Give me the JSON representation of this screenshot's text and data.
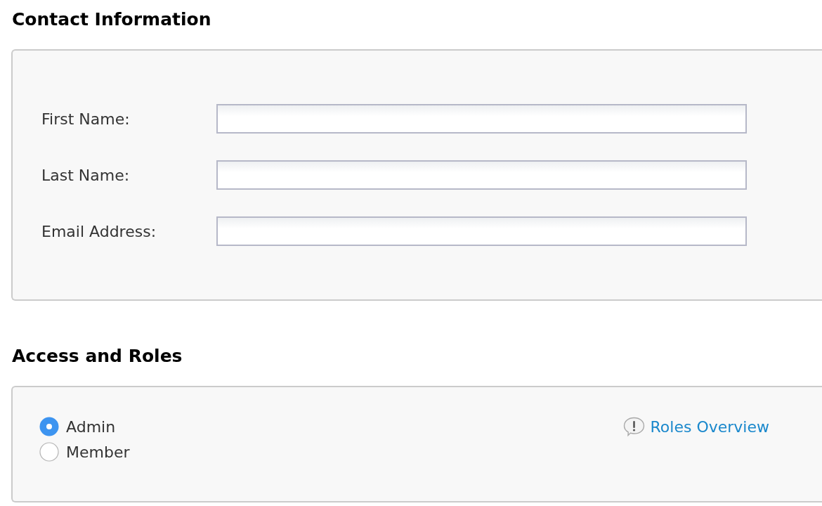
{
  "sections": [
    {
      "kind": "form",
      "title": "Contact Information",
      "fields": [
        {
          "label": "First Name:"
        },
        {
          "label": "Last Name:"
        },
        {
          "label": "Email Address:"
        }
      ]
    },
    {
      "kind": "roles",
      "title": "Access and Roles",
      "options": [
        {
          "label": "Admin",
          "selected": true
        },
        {
          "label": "Member",
          "selected": false
        }
      ],
      "link": {
        "text": "Roles Overview"
      }
    }
  ]
}
